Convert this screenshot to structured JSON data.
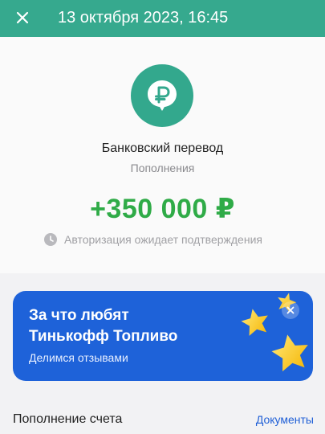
{
  "header": {
    "title": "13 октября 2023, 16:45"
  },
  "transaction": {
    "name": "Банковский перевод",
    "category": "Пополнения",
    "amount": "+350 000 ₽",
    "status": "Авторизация ожидает подтверждения",
    "icon": "ruble-icon"
  },
  "banner": {
    "title_line1": "За что любят",
    "title_line2": "Тинькофф Топливо",
    "subtitle": "Делимся отзывами"
  },
  "section": {
    "title": "Пополнение счета",
    "link": "Документы"
  },
  "colors": {
    "header_bg": "#36a98e",
    "amount": "#2fab47",
    "banner_bg": "#1e62d9",
    "link": "#1f5fd6"
  }
}
